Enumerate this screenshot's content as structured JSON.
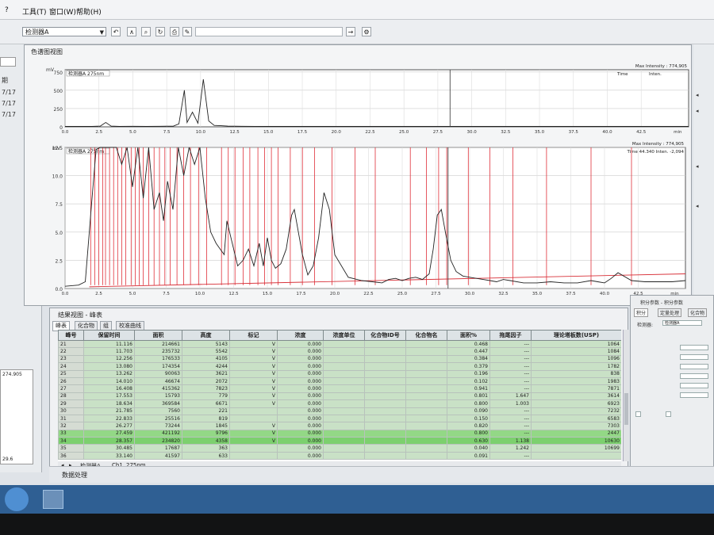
{
  "menu": {
    "help_mark": "?",
    "tools": "工具(T)",
    "window": "窗口(W)",
    "help": "帮助(H)"
  },
  "toolbar": {
    "detector_select": "检测器A"
  },
  "left_panel": {
    "label": "期",
    "items": [
      "7/17",
      "7/17",
      "7/17"
    ],
    "value_top": "274.905",
    "value_bottom": "29.6"
  },
  "chart_panel": {
    "title": "色谱图视图"
  },
  "chart_top": {
    "y_unit": "mV",
    "trace_label": "检测器A 275nm",
    "max_intensity": "Max Intensity : 774,905",
    "y_ticks": [
      "750",
      "500",
      "250",
      "0"
    ],
    "x_ticks": [
      "0.0",
      "2.5",
      "5.0",
      "7.5",
      "10.0",
      "12.5",
      "15.0",
      "17.5",
      "20.0",
      "22.5",
      "25.0",
      "27.5",
      "30.0",
      "32.5",
      "35.0",
      "37.5",
      "40.0",
      "42.5",
      "min"
    ],
    "header_right": [
      "Time",
      "Inten."
    ]
  },
  "chart_data": {
    "type": "line",
    "x_label": "min",
    "y_label": "mV",
    "xlim": [
      0,
      46
    ],
    "ylim": [
      0,
      12.5
    ],
    "y_ticks": [
      0,
      2.5,
      5.0,
      7.5,
      10.0,
      12.5
    ],
    "x_ticks": [
      0,
      2.5,
      5.0,
      7.5,
      10.0,
      12.5,
      15.0,
      17.5,
      20.0,
      22.5,
      25.0,
      27.5,
      30.0,
      32.5,
      35.0,
      37.5,
      40.0,
      42.5
    ],
    "x": [
      0.0,
      1.0,
      1.5,
      2.0,
      2.3,
      2.6,
      3.0,
      3.4,
      3.8,
      4.2,
      4.6,
      5.0,
      5.4,
      5.8,
      6.2,
      6.6,
      7.0,
      7.3,
      7.6,
      8.0,
      8.4,
      8.8,
      9.2,
      9.6,
      10.0,
      10.4,
      10.8,
      11.2,
      11.5,
      11.8,
      12.0,
      12.5,
      12.8,
      13.2,
      13.6,
      14.0,
      14.4,
      14.7,
      15.0,
      15.3,
      15.6,
      16.0,
      16.4,
      16.8,
      17.0,
      17.3,
      17.6,
      18.0,
      18.4,
      18.8,
      19.2,
      19.6,
      20.0,
      21.0,
      22.0,
      22.8,
      23.5,
      24.0,
      24.5,
      25.0,
      25.5,
      26.0,
      26.5,
      27.0,
      27.3,
      27.6,
      27.9,
      28.2,
      28.6,
      29.0,
      29.5,
      30.0,
      30.5,
      31.0,
      31.5,
      32.0,
      32.5,
      33.0,
      34.0,
      35.0,
      36.0,
      37.0,
      38.0,
      39.0,
      39.5,
      40.0,
      40.5,
      41.0,
      42.0,
      43.0,
      44.0,
      45.0,
      46.0
    ],
    "y": [
      0.2,
      0.3,
      0.6,
      8.0,
      12.3,
      12.5,
      12.5,
      12.5,
      12.5,
      11.0,
      12.5,
      9.0,
      12.5,
      8.0,
      12.5,
      7.0,
      8.5,
      6.0,
      9.5,
      7.0,
      12.5,
      10.0,
      12.5,
      11.0,
      12.5,
      8.0,
      5.0,
      4.0,
      3.5,
      3.0,
      6.0,
      3.5,
      2.0,
      2.5,
      3.5,
      2.0,
      4.0,
      2.0,
      4.5,
      2.5,
      1.8,
      2.2,
      3.5,
      6.5,
      7.0,
      5.0,
      3.0,
      1.2,
      2.0,
      4.5,
      8.5,
      7.0,
      3.0,
      1.0,
      0.7,
      0.6,
      0.5,
      0.8,
      0.9,
      0.7,
      0.9,
      1.0,
      0.8,
      1.3,
      3.5,
      6.5,
      7.0,
      5.0,
      2.5,
      1.5,
      1.1,
      1.0,
      0.9,
      0.8,
      0.7,
      0.6,
      0.8,
      0.7,
      0.5,
      0.5,
      0.6,
      0.5,
      0.5,
      0.7,
      0.6,
      0.5,
      0.9,
      1.4,
      0.7,
      0.6,
      0.6,
      0.6,
      0.7
    ],
    "top_trace_x": [
      0,
      2.0,
      2.6,
      3.0,
      3.4,
      4.0,
      5.0,
      6.0,
      7.0,
      8.0,
      8.4,
      8.8,
      9.0,
      9.4,
      9.8,
      10.2,
      10.6,
      11.0,
      11.5,
      12.0,
      13.0,
      14.0,
      15.0,
      16.0,
      17.0,
      18.0,
      20.0,
      22.0,
      25.0,
      27.0,
      30.0,
      35.0,
      40.0,
      46.0
    ],
    "top_trace_y": [
      5,
      5,
      10,
      60,
      10,
      5,
      8,
      5,
      8,
      10,
      40,
      500,
      60,
      200,
      50,
      650,
      80,
      20,
      15,
      10,
      8,
      6,
      5,
      5,
      5,
      5,
      5,
      5,
      5,
      5,
      5,
      5,
      5,
      5
    ],
    "top_ylim": [
      0,
      780
    ],
    "integration_marks_min": [
      1.9,
      2.2,
      2.5,
      2.8,
      3.0,
      3.3,
      3.6,
      3.9,
      4.2,
      4.5,
      4.9,
      5.2,
      5.5,
      5.8,
      6.2,
      6.6,
      7.0,
      7.4,
      7.8,
      8.3,
      8.8,
      9.3,
      9.9,
      10.5,
      11.6,
      12.1,
      12.6,
      13.2,
      13.7,
      14.3,
      14.8,
      15.3,
      15.8,
      16.7,
      17.6,
      18.5,
      19.8,
      21.5,
      23.0,
      25.6,
      26.8,
      27.7,
      28.3,
      29.9,
      31.5,
      33.2,
      35.7,
      39.0,
      42.0
    ],
    "cursor_min": 28.4
  },
  "chart_bottom": {
    "trace_label": "检测器A 275nm",
    "max_intensity": "Max Intensity : 774,905",
    "time_readout": "Time  44.340   Inten.   -2,094"
  },
  "results": {
    "title": "结果视图 - 峰表",
    "tabs": [
      "峰表",
      "化合物",
      "组",
      "校准曲线"
    ],
    "columns": [
      "峰号",
      "保留时间",
      "面积",
      "高度",
      "标记",
      "浓度",
      "浓度单位",
      "化合物ID号",
      "化合物名",
      "面积%",
      "拖尾因子",
      "理论塔板数(USP)"
    ],
    "rows": [
      [
        "21",
        "11.116",
        "214661",
        "5143",
        "V",
        "0.000",
        "",
        "",
        "",
        "0.468",
        "---",
        "1064"
      ],
      [
        "22",
        "11.703",
        "235732",
        "5542",
        "V",
        "0.000",
        "",
        "",
        "",
        "0.447",
        "---",
        "1084"
      ],
      [
        "23",
        "12.256",
        "176533",
        "4105",
        "V",
        "0.000",
        "",
        "",
        "",
        "0.384",
        "---",
        "1096"
      ],
      [
        "24",
        "13.080",
        "174354",
        "4244",
        "V",
        "0.000",
        "",
        "",
        "",
        "0.379",
        "---",
        "1782"
      ],
      [
        "25",
        "13.262",
        "90063",
        "3621",
        "V",
        "0.000",
        "",
        "",
        "",
        "0.196",
        "---",
        "838"
      ],
      [
        "26",
        "14.010",
        "46674",
        "2072",
        "V",
        "0.000",
        "",
        "",
        "",
        "0.102",
        "---",
        "1983"
      ],
      [
        "27",
        "16.408",
        "415362",
        "7823",
        "V",
        "0.000",
        "",
        "",
        "",
        "0.941",
        "---",
        "7871"
      ],
      [
        "28",
        "17.553",
        "15793",
        "779",
        "V",
        "0.000",
        "",
        "",
        "",
        "0.801",
        "1.647",
        "3614"
      ],
      [
        "29",
        "18.634",
        "369584",
        "6671",
        "V",
        "0.000",
        "",
        "",
        "",
        "0.800",
        "1.003",
        "6923"
      ],
      [
        "30",
        "21.785",
        "7560",
        "221",
        "",
        "0.000",
        "",
        "",
        "",
        "0.090",
        "---",
        "7232"
      ],
      [
        "31",
        "22.833",
        "25516",
        "819",
        "",
        "0.000",
        "",
        "",
        "",
        "0.150",
        "---",
        "6583"
      ],
      [
        "32",
        "26.277",
        "73244",
        "1845",
        "V",
        "0.000",
        "",
        "",
        "",
        "0.820",
        "---",
        "7303"
      ],
      [
        "33",
        "27.459",
        "421192",
        "9796",
        "V",
        "0.000",
        "",
        "",
        "",
        "0.800",
        "---",
        "2447"
      ],
      [
        "34",
        "28.357",
        "234820",
        "4358",
        "V",
        "0.000",
        "",
        "",
        "",
        "0.630",
        "1.138",
        "10630"
      ],
      [
        "35",
        "30.485",
        "17687",
        "363",
        "",
        "0.000",
        "",
        "",
        "",
        "0.040",
        "1.242",
        "10699"
      ],
      [
        "36",
        "33.140",
        "41597",
        "633",
        "",
        "0.000",
        "",
        "",
        "",
        "0.091",
        "---",
        ""
      ]
    ],
    "bottom_tabs": [
      "检测器A",
      "Ch1",
      "275nm"
    ]
  },
  "params": {
    "title": "积分参数 - 积分参数",
    "tabs": [
      "积分",
      "定量处理",
      "化合物"
    ],
    "detector_label": "检测器:",
    "detector_value": "检测器A"
  },
  "status": {
    "tab": "数据处理"
  }
}
